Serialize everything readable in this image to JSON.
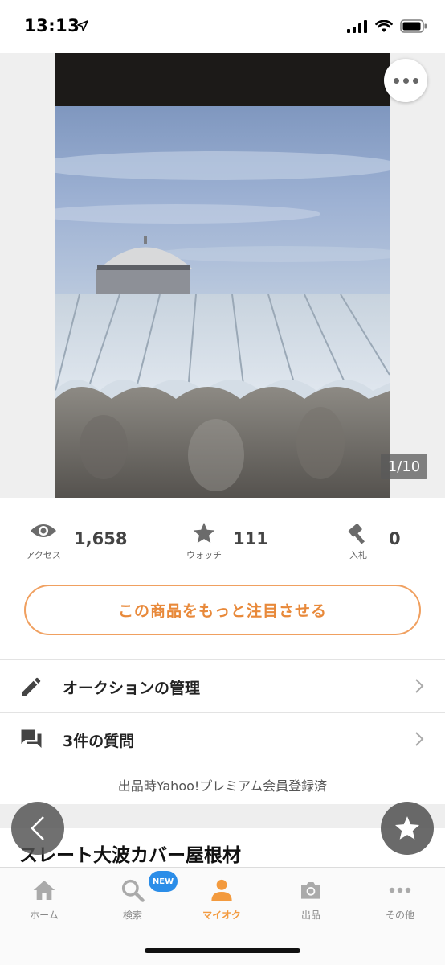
{
  "status_bar": {
    "time": "13:13"
  },
  "gallery": {
    "counter": "1/10"
  },
  "stats": [
    {
      "caption": "アクセス",
      "value": "1,658",
      "icon": "eye-icon"
    },
    {
      "caption": "ウォッチ",
      "value": "111",
      "icon": "star-icon"
    },
    {
      "caption": "入札",
      "value": "0",
      "icon": "gavel-icon"
    }
  ],
  "promote_button": "この商品をもっと注目させる",
  "menu": [
    {
      "label": "オークションの管理",
      "icon": "pencil-icon"
    },
    {
      "label": "3件の質問",
      "icon": "chat-icon"
    }
  ],
  "premium_note": "出品時Yahoo!プレミアム会員登録済",
  "item_title": "スレート大波カバー屋根材",
  "tabs": [
    {
      "label": "ホーム",
      "icon": "home-icon",
      "active": false
    },
    {
      "label": "検索",
      "icon": "search-icon",
      "active": false,
      "badge": "NEW"
    },
    {
      "label": "マイオク",
      "icon": "person-icon",
      "active": true
    },
    {
      "label": "出品",
      "icon": "camera-icon",
      "active": false
    },
    {
      "label": "その他",
      "icon": "more-dots-icon",
      "active": false
    }
  ],
  "colors": {
    "accent": "#f39a3e",
    "badge": "#2b8de8"
  }
}
